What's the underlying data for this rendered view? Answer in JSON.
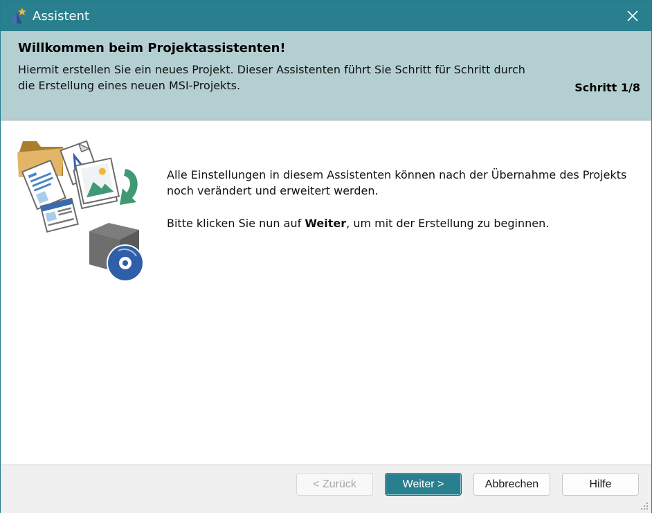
{
  "window": {
    "title": "Assistent"
  },
  "header": {
    "title": "Willkommen beim Projektassistenten!",
    "description": "Hiermit erstellen Sie ein neues Projekt. Dieser Assistenten führt Sie Schritt für Schritt durch die Erstellung eines neuen MSI-Projekts.",
    "step": "Schritt 1/8"
  },
  "content": {
    "paragraph1": "Alle Einstellungen in diesem Assistenten können nach der Übernahme des Projekts noch verändert und erweitert werden.",
    "paragraph2_before": "Bitte klicken Sie nun auf ",
    "paragraph2_bold": "Weiter",
    "paragraph2_after": ", um mit der Erstellung zu beginnen."
  },
  "buttons": {
    "back": "< Zurück",
    "next": "Weiter >",
    "cancel": "Abbrechen",
    "help": "Hilfe"
  },
  "colors": {
    "titlebar": "#2a7f8e",
    "header": "#b4cfd2",
    "primary_button": "#2a7f8e"
  },
  "icons": {
    "app": "wizard-star-icon",
    "close": "close-icon",
    "illustration": "project-files-to-package-illustration",
    "grip": "resize-grip-icon"
  }
}
